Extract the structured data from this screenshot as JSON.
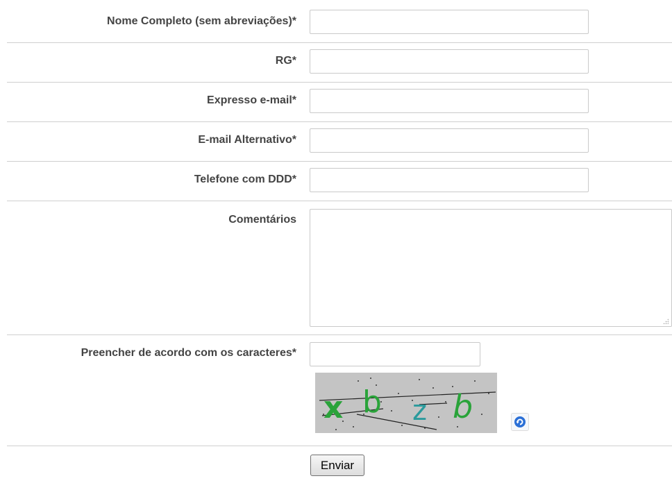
{
  "form": {
    "fields": [
      {
        "label": "Nome Completo (sem abreviações)*",
        "value": ""
      },
      {
        "label": "RG*",
        "value": ""
      },
      {
        "label": "Expresso e-mail*",
        "value": ""
      },
      {
        "label": "E-mail Alternativo*",
        "value": ""
      },
      {
        "label": "Telefone com DDD*",
        "value": ""
      }
    ],
    "comments": {
      "label": "Comentários",
      "value": ""
    },
    "captcha": {
      "label": "Preencher de acordo com os caracteres*",
      "value": "",
      "image_text": "xbzb",
      "refresh_icon": "refresh-icon",
      "colors": {
        "background": "#c4c4c4",
        "green": "#2aa33a",
        "teal": "#2a9a9c",
        "refresh": "#2a6fd6"
      }
    },
    "submit_label": "Enviar"
  }
}
